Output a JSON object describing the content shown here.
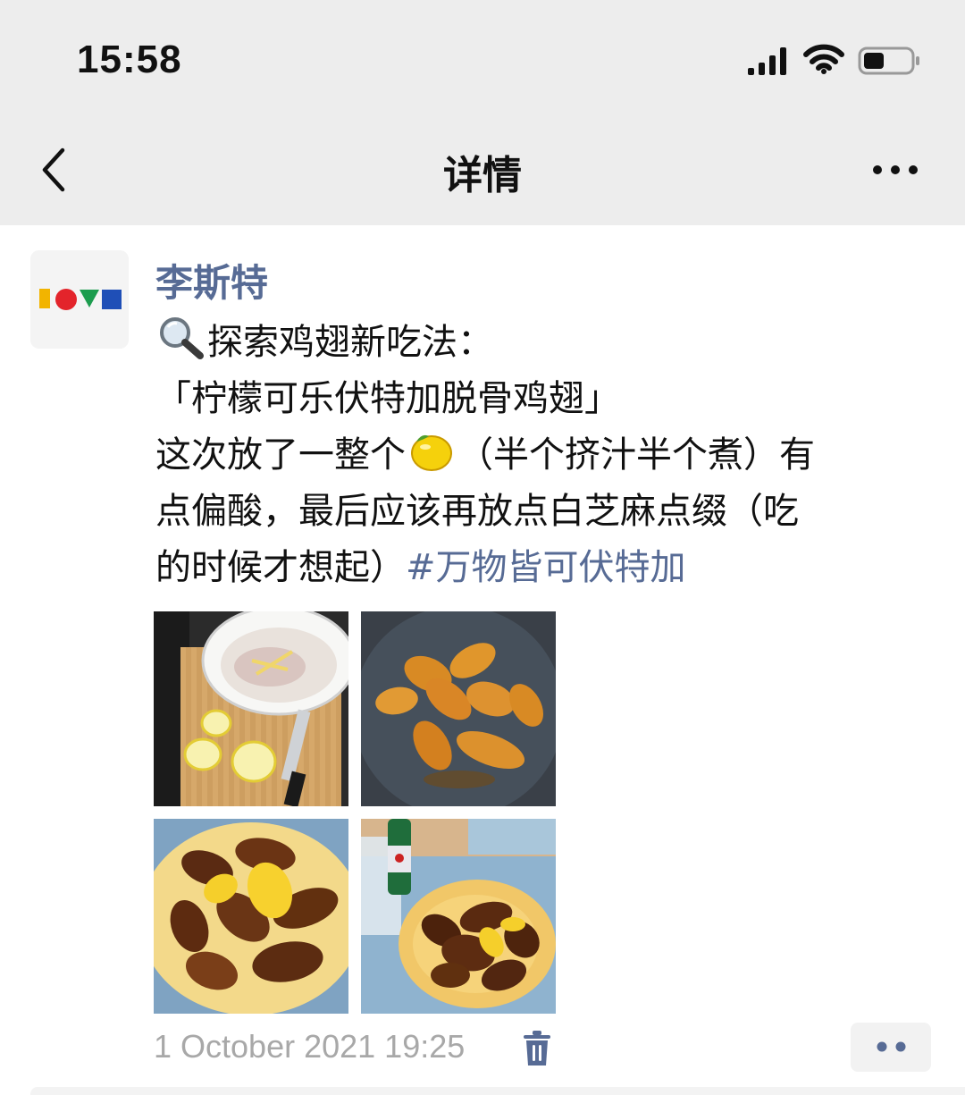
{
  "status_bar": {
    "time": "15:58"
  },
  "nav": {
    "title": "详情"
  },
  "post": {
    "author": "李斯特",
    "lines": {
      "l1": "探索鸡翅新吃法：",
      "l2": "「柠檬可乐伏特加脱骨鸡翅」",
      "l3a": "这次放了一整个",
      "l3b": "（半个挤汁半个煮）有",
      "l4": "点偏酸，最后应该再放点白芝麻点缀（吃",
      "l5": "的时候才想起）",
      "hashtag": "#万物皆可伏特加"
    },
    "emoji": {
      "search": "magnifying-glass",
      "lemon": "lemon"
    },
    "photos": [
      {
        "name": "chicken-prep-with-lemon"
      },
      {
        "name": "wings-frying-in-pan"
      },
      {
        "name": "finished-wings-plate"
      },
      {
        "name": "wings-plate-with-bottle"
      }
    ],
    "timestamp": "1 October 2021 19:25"
  }
}
